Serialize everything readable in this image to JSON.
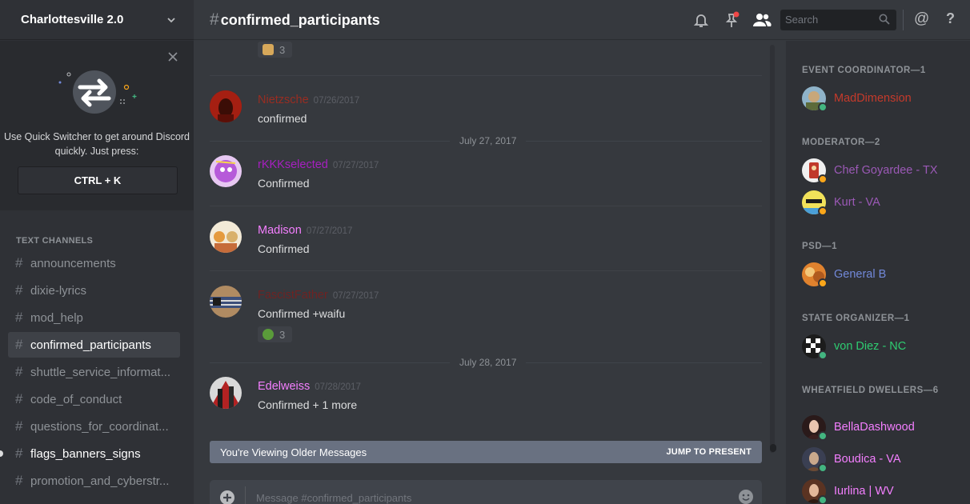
{
  "colors": {
    "online": "#43b581",
    "idle": "#faa61a",
    "accent": "#7289da"
  },
  "server": {
    "name": "Charlottesville 2.0"
  },
  "quick_switcher": {
    "text": "Use Quick Switcher to get around Discord quickly. Just press:",
    "shortcut": "CTRL + K"
  },
  "sidebar": {
    "category": "TEXT CHANNELS",
    "channels": [
      {
        "name": "announcements"
      },
      {
        "name": "dixie-lyrics"
      },
      {
        "name": "mod_help"
      },
      {
        "name": "confirmed_participants"
      },
      {
        "name": "shuttle_service_informat..."
      },
      {
        "name": "code_of_conduct"
      },
      {
        "name": "questions_for_coordinat..."
      },
      {
        "name": "flags_banners_signs"
      },
      {
        "name": "promotion_and_cyberstr..."
      }
    ]
  },
  "header": {
    "hash": "#",
    "channel": "confirmed_participants",
    "search_placeholder": "Search",
    "at": "@",
    "help": "?"
  },
  "messages": {
    "top_reaction_count": "3",
    "items": [
      {
        "user": "Nietzsche",
        "time": "07/26/2017",
        "text": "confirmed",
        "color": "#992d22"
      },
      {
        "user": "rKKKselected",
        "time": "07/27/2017",
        "text": "Confirmed",
        "color": "#a71fc1"
      },
      {
        "user": "Madison",
        "time": "07/27/2017",
        "text": "Confirmed",
        "color": "#f47fff"
      },
      {
        "user": "FascistFather",
        "time": "07/27/2017",
        "text": "Confirmed +waifu",
        "color": "#6e2323",
        "reaction": "3"
      },
      {
        "user": "Edelweiss",
        "time": "07/28/2017",
        "text": "Confirmed + 1 more",
        "color": "#f47fff"
      }
    ],
    "date_divider_1": "July 27, 2017",
    "date_divider_2": "July 28, 2017",
    "older_banner": "You're Viewing Older Messages",
    "jump_to_present": "JUMP TO PRESENT",
    "composer_placeholder": "Message #confirmed_participants"
  },
  "members": {
    "groups": [
      {
        "title": "EVENT COORDINATOR—1"
      },
      {
        "title": "MODERATOR—2"
      },
      {
        "title": "PSD—1"
      },
      {
        "title": "STATE ORGANIZER—1"
      },
      {
        "title": "WHEATFIELD DWELLERS—6"
      }
    ],
    "list": [
      {
        "name": "MadDimension",
        "color": "#c53a2b",
        "status": "online"
      },
      {
        "name": "Chef Goyardee - TX",
        "color": "#9b59b6",
        "status": "idle"
      },
      {
        "name": "Kurt - VA",
        "color": "#9b59b6",
        "status": "idle"
      },
      {
        "name": "General B",
        "color": "#7289da",
        "status": "idle"
      },
      {
        "name": "von Diez - NC",
        "color": "#2ecc71",
        "status": "online"
      },
      {
        "name": "BellaDashwood",
        "color": "#f47fff",
        "status": "online"
      },
      {
        "name": "Boudica - VA",
        "color": "#f47fff",
        "status": "online"
      },
      {
        "name": "Iurlina | WV",
        "color": "#f47fff",
        "status": "online"
      }
    ]
  }
}
